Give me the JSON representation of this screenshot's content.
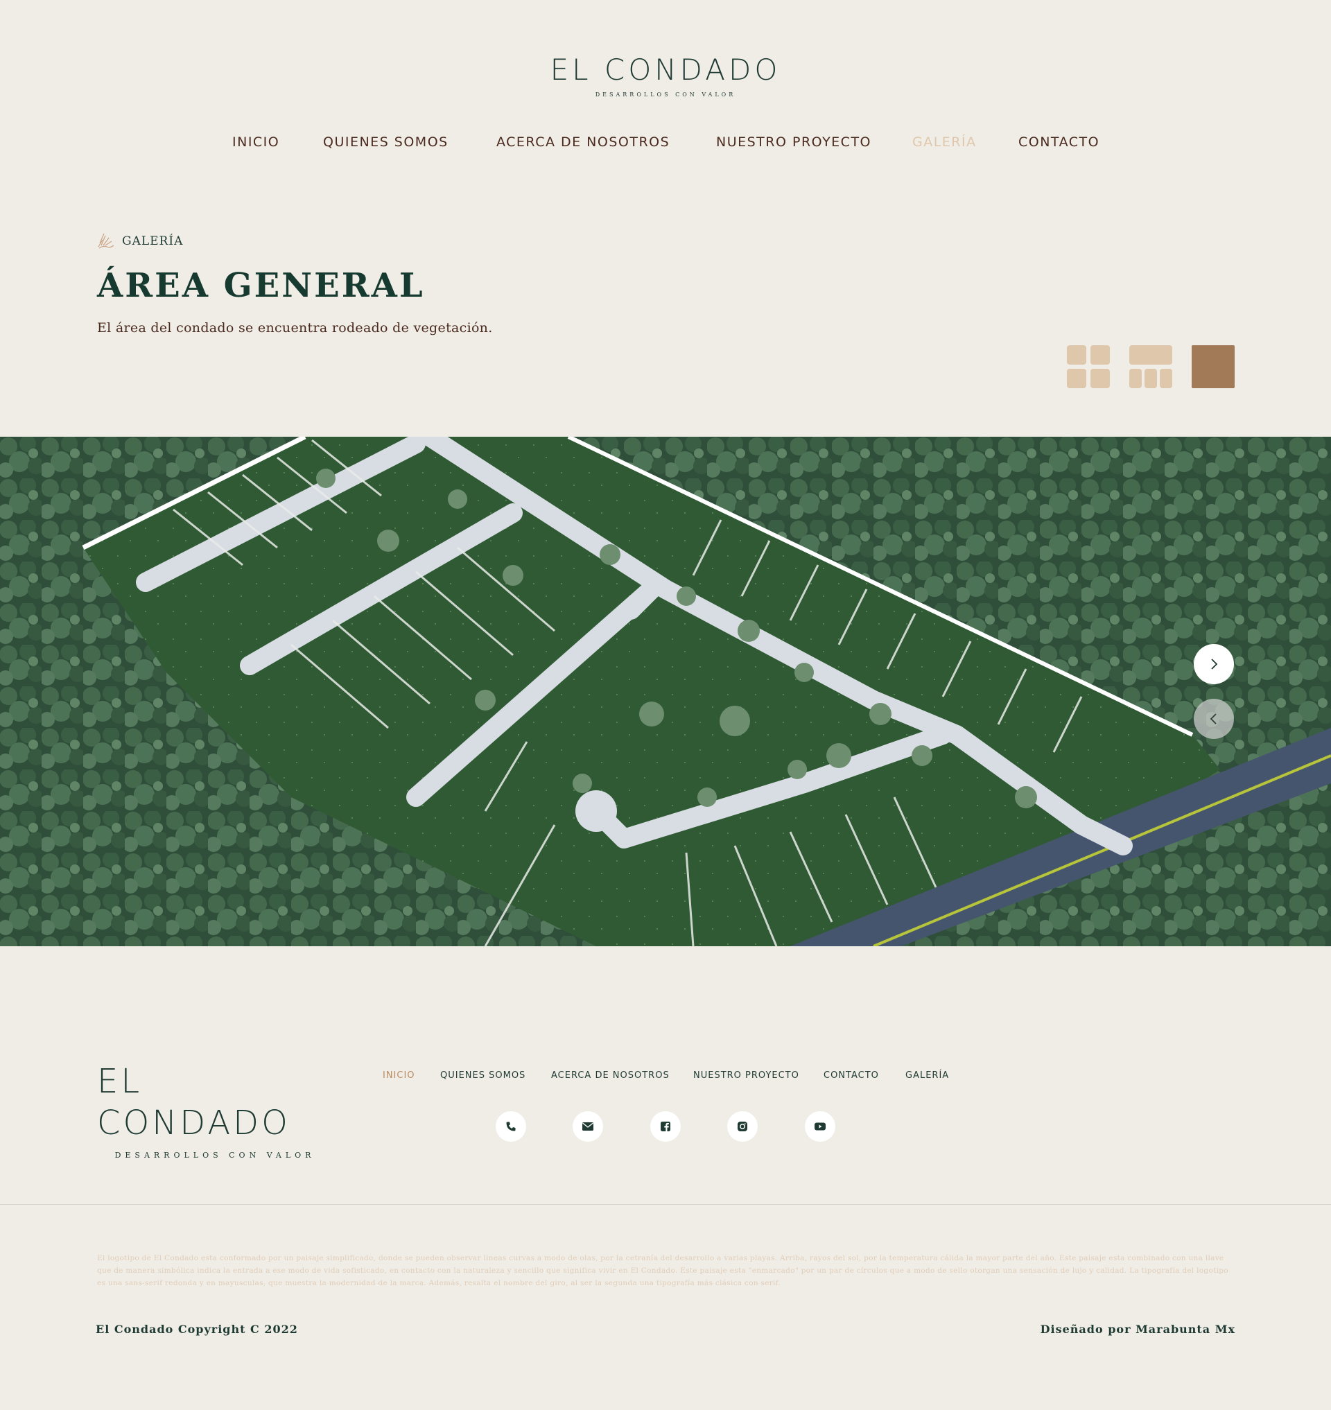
{
  "header": {
    "logo_main": "EL CONDADO",
    "logo_sub": "DESARROLLOS CON VALOR"
  },
  "nav": {
    "items": [
      {
        "label": "INICIO",
        "active": false
      },
      {
        "label": "QUIENES SOMOS",
        "active": false
      },
      {
        "label": "ACERCA DE NOSOTROS",
        "active": false
      },
      {
        "label": "NUESTRO PROYECTO",
        "active": false
      },
      {
        "label": "GALERÍA",
        "active": true
      },
      {
        "label": "CONTACTO",
        "active": false
      }
    ]
  },
  "section": {
    "label": "GALERÍA",
    "title": "ÁREA GENERAL",
    "description": "El área del condado se encuentra rodeado de vegetación."
  },
  "view_toggles": {
    "icons": [
      "grid-4-icon",
      "grid-5-icon",
      "single-view-icon"
    ],
    "selected": "single-view-icon"
  },
  "carousel": {
    "next_icon": "chevron-right-icon",
    "prev_icon": "chevron-left-icon"
  },
  "footer": {
    "logo_main": "EL CONDADO",
    "logo_sub": "DESARROLLOS CON VALOR",
    "nav": [
      {
        "label": "INICIO",
        "active": true
      },
      {
        "label": "QUIENES SOMOS",
        "active": false
      },
      {
        "label": "ACERCA DE NOSOTROS",
        "active": false
      },
      {
        "label": "NUESTRO PROYECTO",
        "active": false
      },
      {
        "label": "CONTACTO",
        "active": false
      },
      {
        "label": "GALERÍA",
        "active": false
      }
    ],
    "social_icons": [
      "phone-icon",
      "email-icon",
      "facebook-icon",
      "instagram-icon",
      "youtube-icon"
    ],
    "fine_print": "El logotipo de El Condado esta conformado por un paisaje simplificado, donde se pueden observar lineas curvas a modo de olas, por la cetranía del desarrollo a varias playas. Arriba, rayos del sol, por la temperatura cálida la mayor parte del año. Este paisaje esta combinado con una llave que de manera simbólica indica la entrada a ese modo de vida sofisticado, en contacto con la naturaleza y sencillo que significa vivir en El Condado. Este paisaje esta \"enmarcado\" por un par de círculos que a modo de sello otorgan una sensación de lujo y calidad. La tipografía del logotipo es una sans-serif redonda y en mayusculas, que muestra la modernidad de la marca. Además, resalta el nombre del giro, al ser la segunda una tipografía más clásica con serif.",
    "copyright": "El Condado Copyright C 2022",
    "designed_by": "Diseñado por Marabunta Mx"
  },
  "colors": {
    "background": "#f0ede7",
    "primary_dark": "#1e3a32",
    "nav_text": "#4a2a1e",
    "active_beige": "#dfc7ab",
    "accent_brown": "#a27a57",
    "footer_active": "#b88a60"
  }
}
